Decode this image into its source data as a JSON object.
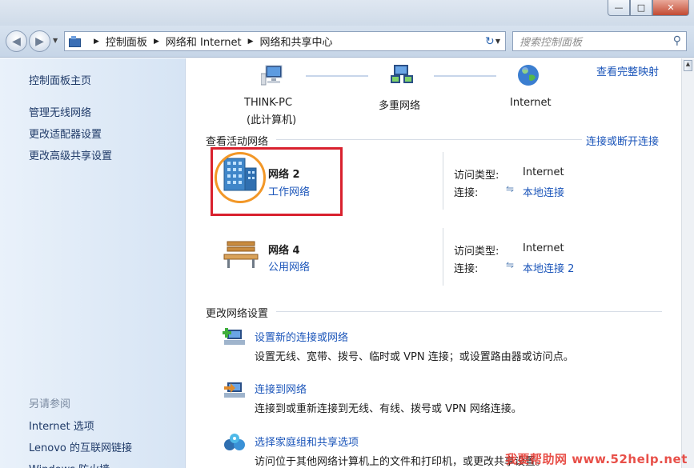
{
  "window": {
    "controls": {
      "minimize": "—",
      "maximize": "□",
      "close": "✕"
    }
  },
  "address": {
    "crumbs": [
      "控制面板",
      "网络和 Internet",
      "网络和共享中心"
    ],
    "search_placeholder": "搜索控制面板"
  },
  "sidebar": {
    "home": "控制面板主页",
    "tasks": [
      "管理无线网络",
      "更改适配器设置",
      "更改高级共享设置"
    ],
    "see_also_title": "另请参阅",
    "see_also": [
      "Internet 选项",
      "Lenovo 的互联网链接",
      "Windows 防火墙"
    ]
  },
  "map": {
    "full_map_link": "查看完整映射",
    "nodes": [
      {
        "name": "THINK-PC",
        "sub": "(此计算机)"
      },
      {
        "name": "多重网络",
        "sub": ""
      },
      {
        "name": "Internet",
        "sub": ""
      }
    ]
  },
  "active": {
    "title": "查看活动网络",
    "connect_link": "连接或断开连接",
    "networks": [
      {
        "name": "网络  2",
        "type": "工作网络",
        "access_label": "访问类型:",
        "access_value": "Internet",
        "conn_label": "连接:",
        "conn_value": "本地连接"
      },
      {
        "name": "网络  4",
        "type": "公用网络",
        "access_label": "访问类型:",
        "access_value": "Internet",
        "conn_label": "连接:",
        "conn_value": "本地连接 2"
      }
    ]
  },
  "change": {
    "title": "更改网络设置",
    "items": [
      {
        "title": "设置新的连接或网络",
        "desc": "设置无线、宽带、拨号、临时或 VPN 连接；或设置路由器或访问点。"
      },
      {
        "title": "连接到网络",
        "desc": "连接到或重新连接到无线、有线、拨号或 VPN 网络连接。"
      },
      {
        "title": "选择家庭组和共享选项",
        "desc": "访问位于其他网络计算机上的文件和打印机，或更改共享设置。"
      }
    ]
  },
  "watermark": "我要帮助网 www.52help.net",
  "colors": {
    "link": "#1c56ba",
    "highlight_box": "#d9212e",
    "highlight_circle": "#f29727"
  }
}
